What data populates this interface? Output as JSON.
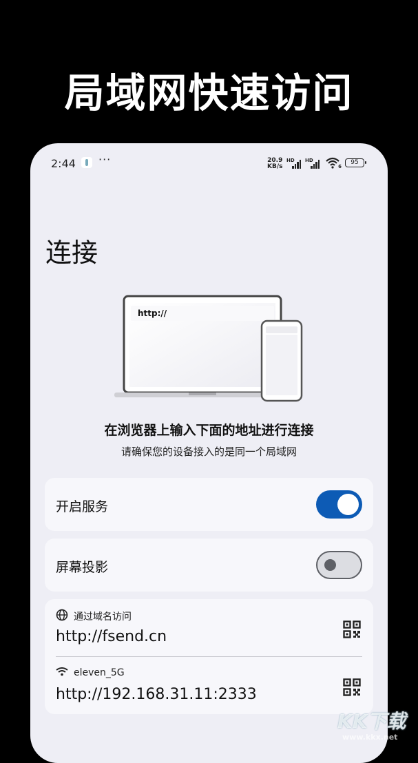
{
  "banner": {
    "title": "局域网快速访问"
  },
  "status_bar": {
    "time": "2:44",
    "more": "···",
    "net_speed_value": "20.9",
    "net_speed_unit": "KB/s",
    "sim1_label": "HD",
    "sim2_label": "HD",
    "wifi_badge": "6",
    "battery": "95"
  },
  "page": {
    "title": "连接"
  },
  "illustration": {
    "url_text": "http://"
  },
  "instructions": {
    "title": "在浏览器上输入下面的地址进行连接",
    "subtitle": "请确保您的设备接入的是同一个局域网"
  },
  "settings": {
    "service": {
      "label": "开启服务",
      "enabled": true
    },
    "screen_cast": {
      "label": "屏幕投影",
      "enabled": false
    }
  },
  "addresses": [
    {
      "icon": "globe-icon",
      "label": "通过域名访问",
      "url": "http://fsend.cn"
    },
    {
      "icon": "wifi-icon",
      "label": "eleven_5G",
      "url": "http://192.168.31.11:2333"
    }
  ],
  "watermark": {
    "logo": "KK下载",
    "url": "www.kkx.net"
  },
  "colors": {
    "accent": "#0d5bb5",
    "background": "#eeeef5",
    "card": "#f7f7fb"
  }
}
